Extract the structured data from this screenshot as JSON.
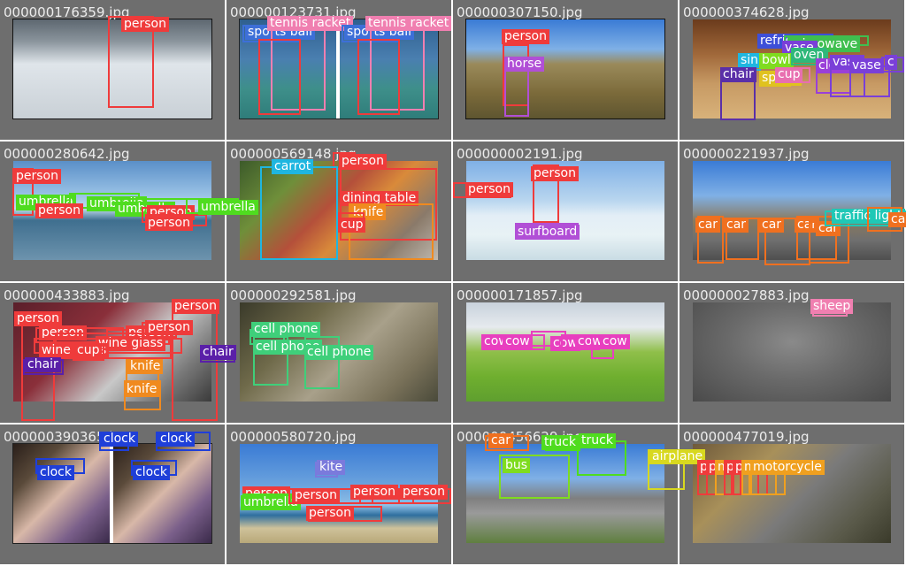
{
  "tiles": [
    {
      "filename": "000000176359.jpg",
      "photo": {
        "bg": "linear-gradient(180deg,#5d6770 0%,#8a949c 22%,#dfe5ea 45%,#c9d0d6 100%)",
        "split": false,
        "frame": "#111111"
      },
      "boxes": [
        {
          "label": "person",
          "color": "#ef3b3b"
        }
      ]
    },
    {
      "filename": "000000123731.jpg",
      "photo": {
        "bg": "linear-gradient(180deg,#2f5f8e 0%,#4a7fb0 40%,#3e8f8a 70%,#2f7d7a 100%)",
        "split": true,
        "frame": "#222222"
      },
      "boxes": [
        {
          "label": "sports ball",
          "color": "#3d6fd8"
        },
        {
          "label": "tennis racket",
          "color": "#f07fb0"
        },
        {
          "label": "",
          "color": "#ef3b3b"
        },
        {
          "label": "sports ball",
          "color": "#3d6fd8"
        },
        {
          "label": "tennis racket",
          "color": "#f07fb0"
        },
        {
          "label": "",
          "color": "#ef3b3b"
        }
      ]
    },
    {
      "filename": "000000307150.jpg",
      "photo": {
        "bg": "linear-gradient(180deg,#3a7bd5 0%,#7fb0e6 30%,#9a8a5a 45%,#7b6a3a 75%,#5e5530 100%)",
        "split": false,
        "frame": "#111111"
      },
      "boxes": [
        {
          "label": "person",
          "color": "#ef3b3b"
        },
        {
          "label": "horse",
          "color": "#b14fd6"
        }
      ]
    },
    {
      "filename": "000000374628.jpg",
      "photo": {
        "bg": "linear-gradient(180deg,#6b3b1c 0%,#a0683a 35%,#c79a64 65%,#d8b27a 100%)",
        "split": false,
        "frame": ""
      },
      "boxes": [
        {
          "label": "refrigerator",
          "color": "#3d4fd8"
        },
        {
          "label": "microwave",
          "color": "#3fbf4f"
        },
        {
          "label": "vase",
          "color": "#7a3fd8"
        },
        {
          "label": "sink",
          "color": "#1fb6e0"
        },
        {
          "label": "bowl",
          "color": "#7fdc1f"
        },
        {
          "label": "oven",
          "color": "#2fb87a"
        },
        {
          "label": "chair",
          "color": "#5a2fa8"
        },
        {
          "label": "spoon",
          "color": "#e0c21f"
        },
        {
          "label": "cup",
          "color": "#e86fb0"
        },
        {
          "label": "clock",
          "color": "#9a3fd8"
        },
        {
          "label": "vase",
          "color": "#7a3fd8"
        },
        {
          "label": "vase",
          "color": "#7a3fd8"
        },
        {
          "label": "c",
          "color": "#7a3fd8"
        }
      ]
    },
    {
      "filename": "000000280642.jpg",
      "photo": {
        "bg": "linear-gradient(180deg,#5a8fc8 0%,#9bc3e6 35%,#c2dced 48%,#3f6f8f 60%,#6d93ad 100%)",
        "split": false,
        "frame": ""
      },
      "boxes": [
        {
          "label": "person",
          "color": "#ef3b3b"
        },
        {
          "label": "umbrella",
          "color": "#4fdc1f"
        },
        {
          "label": "umbrella",
          "color": "#4fdc1f"
        },
        {
          "label": "umbrella",
          "color": "#4fdc1f"
        },
        {
          "label": "person",
          "color": "#ef3b3b"
        },
        {
          "label": "person",
          "color": "#ef3b3b"
        },
        {
          "label": "person",
          "color": "#ef3b3b"
        },
        {
          "label": "umbrella",
          "color": "#4fdc1f"
        }
      ]
    },
    {
      "filename": "000000569148.jpg",
      "photo": {
        "bg": "linear-gradient(135deg,#3c5a2a 0%,#6f8f3a 25%,#b4503a 45%,#d98a3a 60%,#8a7a6a 80%,#bfb8ae 100%)",
        "split": false,
        "frame": ""
      },
      "boxes": [
        {
          "label": "person",
          "color": "#ef3b3b"
        },
        {
          "label": "carrot",
          "color": "#1fb6e0"
        },
        {
          "label": "dining table",
          "color": "#ef3b3b"
        },
        {
          "label": "knife",
          "color": "#f08a1f"
        },
        {
          "label": "cup",
          "color": "#ef3b3b"
        }
      ]
    },
    {
      "filename": "000000002191.jpg",
      "photo": {
        "bg": "linear-gradient(180deg,#7fb0e6 0%,#b9d6ef 40%,#e3eef6 55%,#e8f2f5 75%,#c9dce4 100%)",
        "split": false,
        "frame": ""
      },
      "boxes": [
        {
          "label": "person",
          "color": "#ef3b3b"
        },
        {
          "label": "person",
          "color": "#ef3b3b"
        },
        {
          "label": "surfboard",
          "color": "#b14fd6"
        }
      ]
    },
    {
      "filename": "000000221937.jpg",
      "photo": {
        "bg": "linear-gradient(180deg,#3a7bd5 0%,#7fb0e6 35%,#8a7a5e 60%,#6f6f6f 80%,#4f4f4f 100%)",
        "split": false,
        "frame": ""
      },
      "boxes": [
        {
          "label": "car",
          "color": "#f0701f"
        },
        {
          "label": "car",
          "color": "#f0701f"
        },
        {
          "label": "car",
          "color": "#f0701f"
        },
        {
          "label": "car",
          "color": "#f0701f"
        },
        {
          "label": "car",
          "color": "#f0701f"
        },
        {
          "label": "traffic light",
          "color": "#1fc8b6"
        },
        {
          "label": "car",
          "color": "#f0701f"
        }
      ]
    },
    {
      "filename": "000000433883.jpg",
      "photo": {
        "bg": "linear-gradient(135deg,#5a1f2a 0%,#8a2f3a 35%,#c8c8c8 60%,#7a7a7a 80%,#3a3a3a 100%)",
        "split": false,
        "frame": ""
      },
      "boxes": [
        {
          "label": "person",
          "color": "#ef3b3b"
        },
        {
          "label": "person",
          "color": "#ef3b3b"
        },
        {
          "label": "person",
          "color": "#ef3b3b"
        },
        {
          "label": "person",
          "color": "#ef3b3b"
        },
        {
          "label": "person",
          "color": "#ef3b3b"
        },
        {
          "label": "wine glass",
          "color": "#ef3b3b"
        },
        {
          "label": "wine glass",
          "color": "#ef3b3b"
        },
        {
          "label": "cup",
          "color": "#ef3b3b"
        },
        {
          "label": "chair",
          "color": "#5a1fa8"
        },
        {
          "label": "chair",
          "color": "#5a1fa8"
        },
        {
          "label": "knife",
          "color": "#f08a1f"
        },
        {
          "label": "knife",
          "color": "#f08a1f"
        }
      ]
    },
    {
      "filename": "000000292581.jpg",
      "photo": {
        "bg": "linear-gradient(135deg,#3a3a2a 0%,#6f6a4a 30%,#a8a08a 55%,#7a725a 80%,#4a4a3a 100%)",
        "split": false,
        "frame": ""
      },
      "boxes": [
        {
          "label": "cell phone",
          "color": "#3fcf7a"
        },
        {
          "label": "cell phone",
          "color": "#3fcf7a"
        },
        {
          "label": "cell phone",
          "color": "#3fcf7a"
        }
      ]
    },
    {
      "filename": "000000171857.jpg",
      "photo": {
        "bg": "linear-gradient(180deg,#c8d2dc 0%,#e6eaee 25%,#8fbf4a 50%,#6faf2f 75%,#5f9f2f 100%)",
        "split": false,
        "frame": ""
      },
      "boxes": [
        {
          "label": "cow",
          "color": "#e83fbf"
        },
        {
          "label": "cow",
          "color": "#e83fbf"
        },
        {
          "label": "cow",
          "color": "#e83fbf"
        },
        {
          "label": "cow",
          "color": "#e83fbf"
        },
        {
          "label": "cow",
          "color": "#e83fbf"
        }
      ]
    },
    {
      "filename": "000000027883.jpg",
      "photo": {
        "bg": "radial-gradient(ellipse at 50% 40%,#8a8a8a 0%,#6a6a6a 45%,#4a4a4a 100%)",
        "split": false,
        "frame": ""
      },
      "boxes": [
        {
          "label": "sheep",
          "color": "#f07fb0"
        }
      ]
    },
    {
      "filename": "000000390365.jpg",
      "photo": {
        "bg": "linear-gradient(135deg,#2a1f1a 0%,#5a4a3a 25%,#d8b8a8 50%,#7a5f8a 75%,#3a2a4a 100%)",
        "split": true,
        "frame": "#222222"
      },
      "boxes": [
        {
          "label": "clock",
          "color": "#1f3fd8"
        },
        {
          "label": "clock",
          "color": "#1f3fd8"
        },
        {
          "label": "clock",
          "color": "#1f3fd8"
        },
        {
          "label": "clock",
          "color": "#1f3fd8"
        }
      ]
    },
    {
      "filename": "000000580720.jpg",
      "photo": {
        "bg": "linear-gradient(180deg,#3a7bd5 0%,#6fa6de 45%,#8fbfe6 62%,#2f6f9f 72%,#cfc29a 85%,#b8a87a 100%)",
        "split": false,
        "frame": ""
      },
      "boxes": [
        {
          "label": "kite",
          "color": "#7a7adc"
        },
        {
          "label": "person",
          "color": "#ef3b3b"
        },
        {
          "label": "umbrella",
          "color": "#4fdc1f"
        },
        {
          "label": "person",
          "color": "#ef3b3b"
        },
        {
          "label": "person",
          "color": "#ef3b3b"
        },
        {
          "label": "person",
          "color": "#ef3b3b"
        },
        {
          "label": "person",
          "color": "#ef3b3b"
        }
      ]
    },
    {
      "filename": "000000456629.jpg",
      "photo": {
        "bg": "linear-gradient(180deg,#3a7bd5 0%,#7fb0e6 35%,#7f7f7f 55%,#9a9a9a 70%,#5f7f3f 100%)",
        "split": false,
        "frame": ""
      },
      "boxes": [
        {
          "label": "car",
          "color": "#f0701f"
        },
        {
          "label": "truck",
          "color": "#4fdc1f"
        },
        {
          "label": "bus",
          "color": "#7fdc1f"
        },
        {
          "label": "truck",
          "color": "#4fdc1f"
        },
        {
          "label": "airplane",
          "color": "#d8d81f"
        }
      ]
    },
    {
      "filename": "000000477019.jpg",
      "photo": {
        "bg": "linear-gradient(135deg,#6f5a3a 0%,#a8905a 30%,#7a7a7a 55%,#5a5a4a 80%,#3a3a2a 100%)",
        "split": false,
        "frame": ""
      },
      "boxes": [
        {
          "label": "person",
          "color": "#ef3b3b"
        },
        {
          "label": "person",
          "color": "#ef3b3b"
        },
        {
          "label": "motorcycle",
          "color": "#f0a01f"
        },
        {
          "label": "person",
          "color": "#ef3b3b"
        },
        {
          "label": "person",
          "color": "#ef3b3b"
        },
        {
          "label": "motorcycle",
          "color": "#f0a01f"
        },
        {
          "label": "motorcycle",
          "color": "#f0a01f"
        }
      ]
    }
  ]
}
